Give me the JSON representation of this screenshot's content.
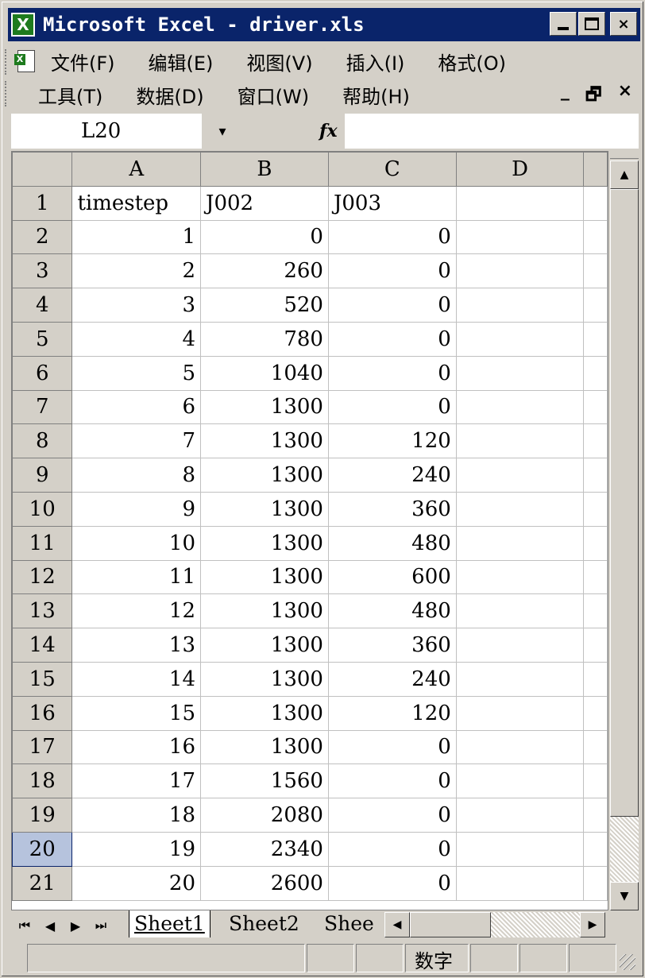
{
  "window": {
    "title": "Microsoft Excel - driver.xls",
    "app_icon": "excel-icon",
    "buttons": {
      "minimize": "minimize-icon",
      "maximize": "maximize-icon",
      "close": "×"
    }
  },
  "menu": {
    "row1": [
      "文件(F)",
      "编辑(E)",
      "视图(V)",
      "插入(I)",
      "格式(O)"
    ],
    "row2": [
      "工具(T)",
      "数据(D)",
      "窗口(W)",
      "帮助(H)"
    ],
    "mdi_controls": {
      "minimize": "_",
      "restore": "🗗",
      "close": "×"
    }
  },
  "formula_bar": {
    "name_box": "L20",
    "dropdown": "▾",
    "fx": "fx",
    "content": ""
  },
  "grid": {
    "columns": [
      "A",
      "B",
      "C",
      "D"
    ],
    "rows": [
      {
        "n": "1",
        "a": "timestep",
        "b": "J002",
        "c": "J003",
        "d": ""
      },
      {
        "n": "2",
        "a": "1",
        "b": "0",
        "c": "0",
        "d": ""
      },
      {
        "n": "3",
        "a": "2",
        "b": "260",
        "c": "0",
        "d": ""
      },
      {
        "n": "4",
        "a": "3",
        "b": "520",
        "c": "0",
        "d": ""
      },
      {
        "n": "5",
        "a": "4",
        "b": "780",
        "c": "0",
        "d": ""
      },
      {
        "n": "6",
        "a": "5",
        "b": "1040",
        "c": "0",
        "d": ""
      },
      {
        "n": "7",
        "a": "6",
        "b": "1300",
        "c": "0",
        "d": ""
      },
      {
        "n": "8",
        "a": "7",
        "b": "1300",
        "c": "120",
        "d": ""
      },
      {
        "n": "9",
        "a": "8",
        "b": "1300",
        "c": "240",
        "d": ""
      },
      {
        "n": "10",
        "a": "9",
        "b": "1300",
        "c": "360",
        "d": ""
      },
      {
        "n": "11",
        "a": "10",
        "b": "1300",
        "c": "480",
        "d": ""
      },
      {
        "n": "12",
        "a": "11",
        "b": "1300",
        "c": "600",
        "d": ""
      },
      {
        "n": "13",
        "a": "12",
        "b": "1300",
        "c": "480",
        "d": ""
      },
      {
        "n": "14",
        "a": "13",
        "b": "1300",
        "c": "360",
        "d": ""
      },
      {
        "n": "15",
        "a": "14",
        "b": "1300",
        "c": "240",
        "d": ""
      },
      {
        "n": "16",
        "a": "15",
        "b": "1300",
        "c": "120",
        "d": ""
      },
      {
        "n": "17",
        "a": "16",
        "b": "1300",
        "c": "0",
        "d": ""
      },
      {
        "n": "18",
        "a": "17",
        "b": "1560",
        "c": "0",
        "d": ""
      },
      {
        "n": "19",
        "a": "18",
        "b": "2080",
        "c": "0",
        "d": ""
      },
      {
        "n": "20",
        "a": "19",
        "b": "2340",
        "c": "0",
        "d": ""
      },
      {
        "n": "21",
        "a": "20",
        "b": "2600",
        "c": "0",
        "d": ""
      }
    ],
    "active_row": "20"
  },
  "sheet_tabs": {
    "nav": [
      "⏮",
      "◀",
      "▶",
      "⏭"
    ],
    "tabs": [
      "Sheet1",
      "Sheet2",
      "Shee"
    ],
    "active": "Sheet1"
  },
  "status_bar": {
    "mode": "数字"
  },
  "colors": {
    "title_bar": "#0a246a",
    "chrome": "#d4d0c8",
    "active_row_header": "#b6c3dd",
    "excel_green": "#1e7b1e"
  }
}
